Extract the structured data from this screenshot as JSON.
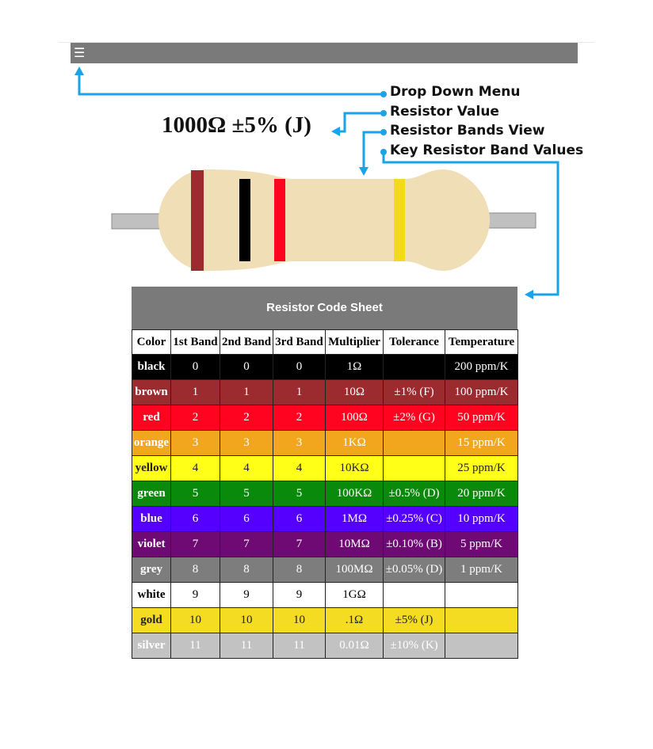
{
  "header": {
    "menu_icon": "hamburger-icon",
    "menu_glyph": "☰"
  },
  "resistor_value": "1000Ω ±5% (J)",
  "callouts": {
    "dropdown": "Drop Down Menu",
    "value": "Resistor Value",
    "bands_view": "Resistor Bands View",
    "key_values": "Key Resistor Band Values"
  },
  "resistor": {
    "body_color": "#f0dfb6",
    "lead_color": "#c0c0c0",
    "bands": [
      "#9b2b2f",
      "#000000",
      "#ff0320",
      "#f2da1a"
    ]
  },
  "accent_color": "#1aa3e8",
  "sheet": {
    "title": "Resistor Code Sheet",
    "headers": [
      "Color",
      "1st Band",
      "2nd Band",
      "3rd Band",
      "Multiplier",
      "Tolerance",
      "Temperature"
    ],
    "rows": [
      {
        "color": "#000000",
        "text": "#ffffff",
        "cells": [
          "black",
          "0",
          "0",
          "0",
          "1Ω",
          "",
          "200 ppm/K"
        ]
      },
      {
        "color": "#9b2b2f",
        "text": "#ffffff",
        "cells": [
          "brown",
          "1",
          "1",
          "1",
          "10Ω",
          "±1% (F)",
          "100 ppm/K"
        ]
      },
      {
        "color": "#ff0320",
        "text": "#ffffff",
        "cells": [
          "red",
          "2",
          "2",
          "2",
          "100Ω",
          "±2% (G)",
          "50 ppm/K"
        ]
      },
      {
        "color": "#f2a61d",
        "text": "#ffffff",
        "cells": [
          "orange",
          "3",
          "3",
          "3",
          "1KΩ",
          "",
          "15 ppm/K"
        ]
      },
      {
        "color": "#ffff18",
        "text": "#222222",
        "cells": [
          "yellow",
          "4",
          "4",
          "4",
          "10KΩ",
          "",
          "25 ppm/K"
        ]
      },
      {
        "color": "#0a8a0a",
        "text": "#ffffff",
        "cells": [
          "green",
          "5",
          "5",
          "5",
          "100KΩ",
          "±0.5% (D)",
          "20 ppm/K"
        ]
      },
      {
        "color": "#5500ff",
        "text": "#ffffff",
        "cells": [
          "blue",
          "6",
          "6",
          "6",
          "1MΩ",
          "±0.25% (C)",
          "10 ppm/K"
        ]
      },
      {
        "color": "#6f0a75",
        "text": "#ffffff",
        "cells": [
          "violet",
          "7",
          "7",
          "7",
          "10MΩ",
          "±0.10% (B)",
          "5 ppm/K"
        ]
      },
      {
        "color": "#7d7d7d",
        "text": "#ffffff",
        "cells": [
          "grey",
          "8",
          "8",
          "8",
          "100MΩ",
          "±0.05% (D)",
          "1 ppm/K"
        ]
      },
      {
        "color": "#ffffff",
        "text": "#000000",
        "cells": [
          "white",
          "9",
          "9",
          "9",
          "1GΩ",
          "",
          ""
        ]
      },
      {
        "color": "#f4dc22",
        "text": "#222222",
        "cells": [
          "gold",
          "10",
          "10",
          "10",
          ".1Ω",
          "±5% (J)",
          ""
        ]
      },
      {
        "color": "#c2c2c2",
        "text": "#ffffff",
        "cells": [
          "silver",
          "11",
          "11",
          "11",
          "0.01Ω",
          "±10% (K)",
          ""
        ]
      }
    ]
  }
}
